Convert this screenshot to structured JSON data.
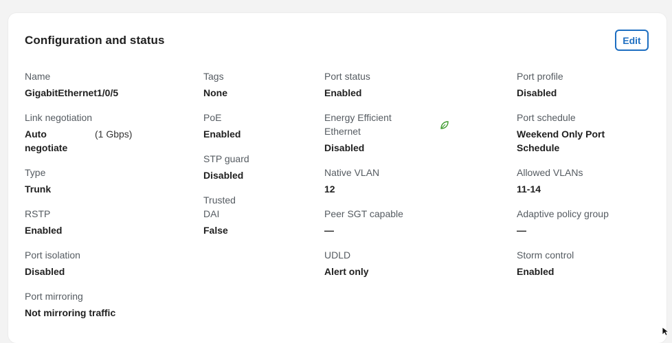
{
  "card": {
    "title": "Configuration and status",
    "edit_label": "Edit"
  },
  "fields": {
    "name": {
      "label": "Name",
      "value": "GigabitEthernet1/0/5"
    },
    "link_negotiation": {
      "label": "Link negotiation",
      "value_main": "Auto negotiate",
      "value_speed": "(1 Gbps)"
    },
    "type": {
      "label": "Type",
      "value": "Trunk"
    },
    "rstp": {
      "label": "RSTP",
      "value": "Enabled"
    },
    "port_isolation": {
      "label": "Port isolation",
      "value": "Disabled"
    },
    "port_mirroring": {
      "label": "Port mirroring",
      "value": "Not mirroring traffic"
    },
    "tags": {
      "label": "Tags",
      "value": "None"
    },
    "poe": {
      "label": "PoE",
      "value": "Enabled"
    },
    "stp_guard": {
      "label": "STP guard",
      "value": "Disabled"
    },
    "trusted_dai": {
      "label": "Trusted DAI",
      "value": "False"
    },
    "port_status": {
      "label": "Port status",
      "value": "Enabled"
    },
    "energy_efficient": {
      "label": "Energy Efficient Ethernet",
      "value": "Disabled",
      "icon": "leaf-icon"
    },
    "native_vlan": {
      "label": "Native VLAN",
      "value": "12"
    },
    "peer_sgt": {
      "label": "Peer SGT capable",
      "value": "—"
    },
    "udld": {
      "label": "UDLD",
      "value": "Alert only"
    },
    "port_profile": {
      "label": "Port profile",
      "value": "Disabled"
    },
    "port_schedule": {
      "label": "Port schedule",
      "value": "Weekend Only Port Schedule"
    },
    "allowed_vlans": {
      "label": "Allowed VLANs",
      "value": "11-14"
    },
    "adaptive_policy": {
      "label": "Adaptive policy group",
      "value": "—"
    },
    "storm_control": {
      "label": "Storm control",
      "value": "Enabled"
    }
  },
  "colors": {
    "accent": "#1d6ec1",
    "leaf": "#3f9b2f",
    "label": "#555b61",
    "value": "#202020"
  }
}
